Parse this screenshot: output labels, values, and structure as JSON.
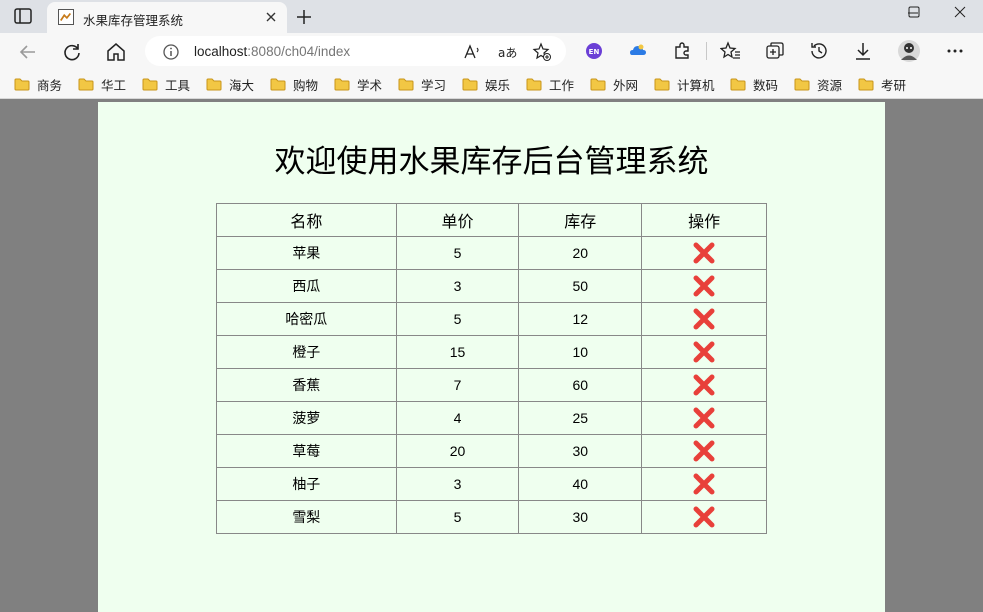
{
  "browser": {
    "tab_title": "水果库存管理系统",
    "url_host": "localhost",
    "url_path": ":8080/ch04/index",
    "extension_badge": "EN",
    "colors": {
      "chrome": "#dee1e6",
      "toolbar": "#f7f7f7",
      "accent_ext": "#6b3fd6",
      "folder": "#f2c744"
    }
  },
  "bookmarks": [
    "商务",
    "华工",
    "工具",
    "海大",
    "购物",
    "学术",
    "学习",
    "娱乐",
    "工作",
    "外网",
    "计算机",
    "数码",
    "资源",
    "考研"
  ],
  "page": {
    "title": "欢迎使用水果库存后台管理系统",
    "background": "#efffef"
  },
  "table": {
    "headers": [
      "名称",
      "单价",
      "库存",
      "操作"
    ],
    "rows": [
      {
        "name": "苹果",
        "price": "5",
        "stock": "20"
      },
      {
        "name": "西瓜",
        "price": "3",
        "stock": "50"
      },
      {
        "name": "哈密瓜",
        "price": "5",
        "stock": "12"
      },
      {
        "name": "橙子",
        "price": "15",
        "stock": "10"
      },
      {
        "name": "香蕉",
        "price": "7",
        "stock": "60"
      },
      {
        "name": "菠萝",
        "price": "4",
        "stock": "25"
      },
      {
        "name": "草莓",
        "price": "20",
        "stock": "30"
      },
      {
        "name": "柚子",
        "price": "3",
        "stock": "40"
      },
      {
        "name": "雪梨",
        "price": "5",
        "stock": "30"
      }
    ],
    "delete_icon": "cross-mark-icon",
    "delete_color": "#e8403a"
  }
}
